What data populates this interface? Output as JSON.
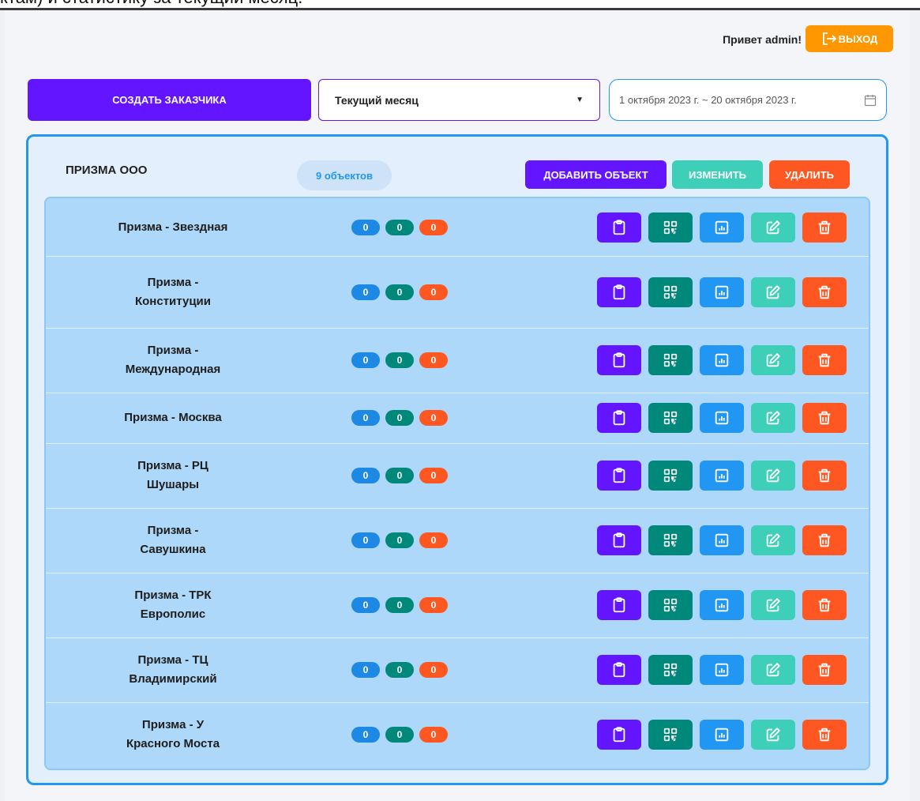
{
  "header": {
    "banner_text": "ктам) и статистику за текущий месяц.",
    "greeting": "Привет admin!",
    "logout_label": "ВЫХОД"
  },
  "toolbar": {
    "create_label": "СОЗДАТЬ ЗАКАЗЧИКА",
    "period_value": "Текущий месяц",
    "date_range": "1 октября 2023 г. ~ 20 октября 2023 г."
  },
  "customer": {
    "name": "ПРИЗМА ООО",
    "objects_count": "9 объектов",
    "add_object_label": "ДОБАВИТЬ ОБЪЕКТ",
    "edit_label": "ИЗМЕНИТЬ",
    "delete_label": "УДАЛИТЬ"
  },
  "objects": [
    {
      "name": "Призма - Звездная",
      "c1": "0",
      "c2": "0",
      "c3": "0"
    },
    {
      "name": "Призма - Конституции",
      "c1": "0",
      "c2": "0",
      "c3": "0"
    },
    {
      "name": "Призма - Международная",
      "c1": "0",
      "c2": "0",
      "c3": "0"
    },
    {
      "name": "Призма - Москва",
      "c1": "0",
      "c2": "0",
      "c3": "0"
    },
    {
      "name": "Призма - РЦ Шушары",
      "c1": "0",
      "c2": "0",
      "c3": "0"
    },
    {
      "name": "Призма - Савушкина",
      "c1": "0",
      "c2": "0",
      "c3": "0"
    },
    {
      "name": "Призма - ТРК Европолис",
      "c1": "0",
      "c2": "0",
      "c3": "0"
    },
    {
      "name": "Призма - ТЦ Владимирский",
      "c1": "0",
      "c2": "0",
      "c3": "0"
    },
    {
      "name": "Призма - У Красного Моста",
      "c1": "0",
      "c2": "0",
      "c3": "0"
    }
  ],
  "row_actions": [
    "clipboard-icon",
    "qr-code-icon",
    "statistics-icon",
    "edit-icon",
    "trash-icon"
  ],
  "colors": {
    "primary": "#6315ff",
    "accent_blue": "#2196f3",
    "teal": "#00897b",
    "mint": "#3ecfb8",
    "danger": "#ff5722",
    "warning": "#ff9800"
  }
}
